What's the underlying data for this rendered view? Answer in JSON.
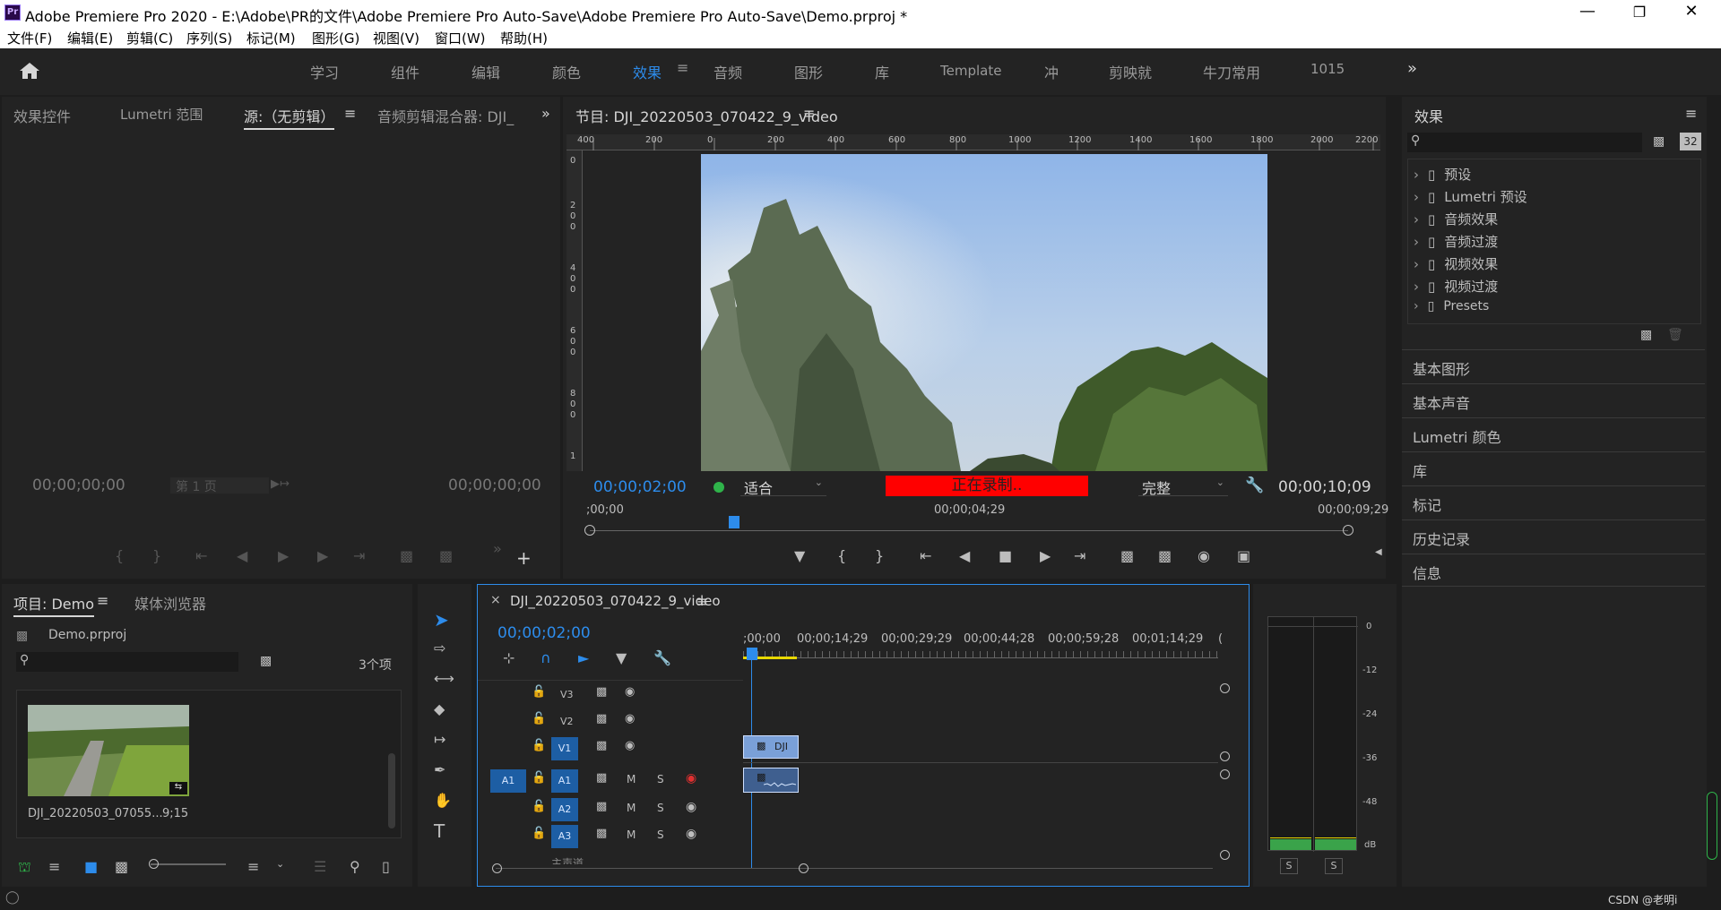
{
  "window": {
    "title": "Adobe Premiere Pro 2020 - E:\\Adobe\\PR的文件\\Adobe Premiere Pro Auto-Save\\Adobe Premiere Pro Auto-Save\\Demo.prproj *",
    "logo": "Pr"
  },
  "menu": [
    "文件(F)",
    "编辑(E)",
    "剪辑(C)",
    "序列(S)",
    "标记(M)",
    "图形(G)",
    "视图(V)",
    "窗口(W)",
    "帮助(H)"
  ],
  "workspaces": {
    "items": [
      "学习",
      "组件",
      "编辑",
      "颜色",
      "效果",
      "音频",
      "图形",
      "库",
      "Template",
      "冲",
      "剪映就",
      "牛刀常用",
      "1015"
    ],
    "active": "效果"
  },
  "source_panel": {
    "tabs": [
      "效果控件",
      "Lumetri 范围",
      "源:（无剪辑）",
      "音频剪辑混合器: DJI_"
    ],
    "active_tab": "源:（无剪辑）",
    "timecode_left": "00;00;00;00",
    "timecode_right": "00;00;00;00",
    "page_label": "第 1 页"
  },
  "program_panel": {
    "title": "节目: DJI_20220503_070422_9_video",
    "ruler_labels": [
      "400",
      "200",
      "0",
      "200",
      "400",
      "600",
      "800",
      "1000",
      "1200",
      "1400",
      "1600",
      "1800",
      "2000",
      "2200"
    ],
    "vruler_labels": [
      "0",
      "2 0 0",
      "4 0 0",
      "6 0 0",
      "8 0 0",
      "1"
    ],
    "timecode_current": "00;00;02;00",
    "fit_option": "适合",
    "recording_text": "正在录制..",
    "quality_option": "完整",
    "timecode_duration": "00;00;10;09",
    "scrub_start": ";00;00",
    "scrub_mid": "00;00;04;29",
    "scrub_end": "00;00;09;29",
    "playhead_fraction": 0.19
  },
  "effects_panel": {
    "title": "效果",
    "badge": "32",
    "tree": [
      "预设",
      "Lumetri 预设",
      "音频效果",
      "音频过渡",
      "视频效果",
      "视频过渡",
      "Presets"
    ],
    "sections": [
      "基本图形",
      "基本声音",
      "Lumetri 颜色",
      "库",
      "标记",
      "历史记录",
      "信息"
    ]
  },
  "project_panel": {
    "tabs": [
      "项目: Demo",
      "媒体浏览器"
    ],
    "project_file": "Demo.prproj",
    "item_count": "3个项",
    "clip_name": "DJI_20220503_07055...",
    "clip_duration": "9;15"
  },
  "timeline": {
    "sequence_name": "DJI_20220503_070422_9_video",
    "timecode": "00;00;02;00",
    "ruler": [
      ";00;00",
      "00;00;14;29",
      "00;00;29;29",
      "00;00;44;28",
      "00;00;59;28",
      "00;01;14;29",
      "("
    ],
    "video_tracks": [
      "V3",
      "V2",
      "V1"
    ],
    "audio_tracks": [
      "A1",
      "A2",
      "A3"
    ],
    "source_patch": "A1",
    "clip_label": "DJI",
    "mute_label": "M",
    "solo_label": "S",
    "master_label": "主声道"
  },
  "meter": {
    "scale": [
      "0",
      "-12",
      "-24",
      "-36",
      "-48",
      "dB"
    ],
    "solo_buttons": [
      "S",
      "S"
    ]
  },
  "watermark": "CSDN @老明i",
  "colors": {
    "accent": "#2d8ceb",
    "recording": "#ff0000",
    "track_blue": "#1d5ea4",
    "meter_green": "#3aa34a"
  }
}
